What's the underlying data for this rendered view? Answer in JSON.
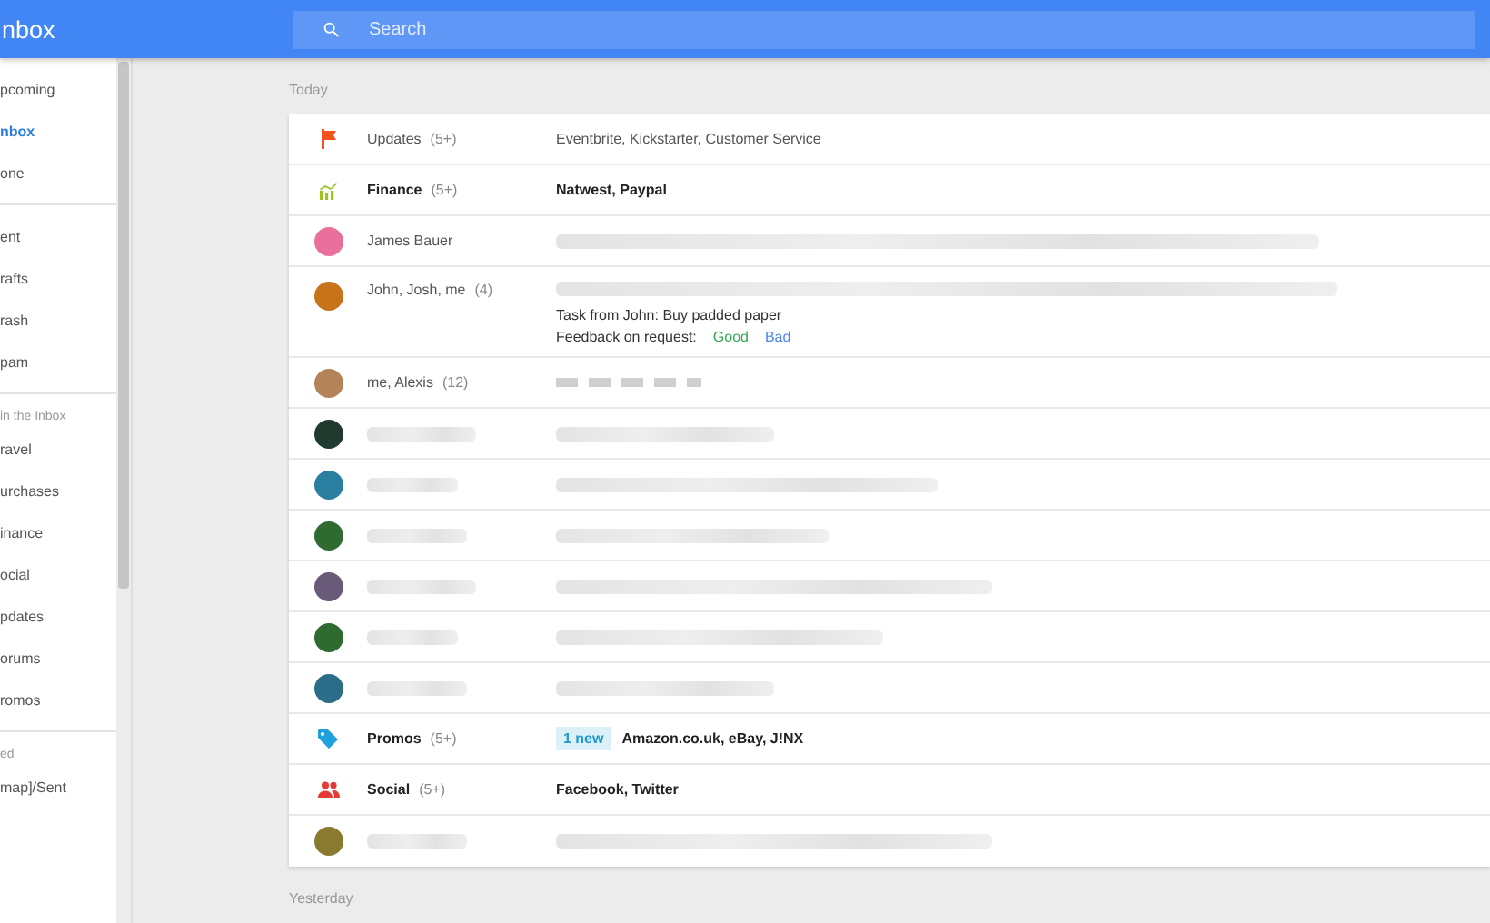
{
  "header": {
    "title": "nbox",
    "search": {
      "placeholder": "Search"
    }
  },
  "sidebar": {
    "groups": [
      {
        "items": [
          {
            "label": "pcoming",
            "selected": false
          },
          {
            "label": "nbox",
            "selected": true
          },
          {
            "label": "one",
            "selected": false
          }
        ]
      },
      {
        "items": [
          {
            "label": "ent",
            "selected": false
          },
          {
            "label": "rafts",
            "selected": false
          },
          {
            "label": "rash",
            "selected": false
          },
          {
            "label": "pam",
            "selected": false
          }
        ]
      },
      {
        "heading": "in the Inbox",
        "items": [
          {
            "label": "ravel",
            "selected": false
          },
          {
            "label": "urchases",
            "selected": false
          },
          {
            "label": "inance",
            "selected": false
          },
          {
            "label": "ocial",
            "selected": false
          },
          {
            "label": "pdates",
            "selected": false
          },
          {
            "label": "orums",
            "selected": false
          },
          {
            "label": "romos",
            "selected": false
          }
        ]
      },
      {
        "heading": "ed",
        "items": [
          {
            "label": "map]/Sent",
            "selected": false
          }
        ]
      }
    ]
  },
  "sections": [
    {
      "label": "Today",
      "rows": [
        {
          "kind": "updates",
          "label": "Updates",
          "count": "(5+)",
          "unread": false,
          "summary": "Eventbrite, Kickstarter, Customer Service"
        },
        {
          "kind": "finance",
          "label": "Finance",
          "count": "(5+)",
          "unread": true,
          "summary": "Natwest, Paypal"
        },
        {
          "kind": "person",
          "color": "#e8709a",
          "sender": "James Bauer"
        },
        {
          "kind": "person",
          "color": "#c8731a",
          "sender": "John, Josh, me",
          "count": "(4)",
          "task": "Task from John: Buy padded paper",
          "feedback": {
            "label": "Feedback on request:",
            "good": "Good",
            "bad": "Bad"
          }
        },
        {
          "kind": "person",
          "color": "#b5835a",
          "sender": "me, Alexis",
          "count": "(12)",
          "short": true
        },
        {
          "kind": "hidden",
          "color": "#203a2f"
        },
        {
          "kind": "hidden",
          "color": "#2a7fa0"
        },
        {
          "kind": "hidden",
          "color": "#2f6a30"
        },
        {
          "kind": "hidden",
          "color": "#6a5a7a"
        },
        {
          "kind": "hidden",
          "color": "#2f6a30"
        },
        {
          "kind": "hidden",
          "color": "#2b6e8a"
        },
        {
          "kind": "promos",
          "label": "Promos",
          "count": "(5+)",
          "unread": true,
          "badge": "1 new",
          "summary": "Amazon.co.uk, eBay, J!NX"
        },
        {
          "kind": "social",
          "label": "Social",
          "count": "(5+)",
          "unread": true,
          "summary": "Facebook, Twitter"
        },
        {
          "kind": "hidden",
          "color": "#8a7a30"
        }
      ]
    },
    {
      "label": "Yesterday"
    }
  ]
}
